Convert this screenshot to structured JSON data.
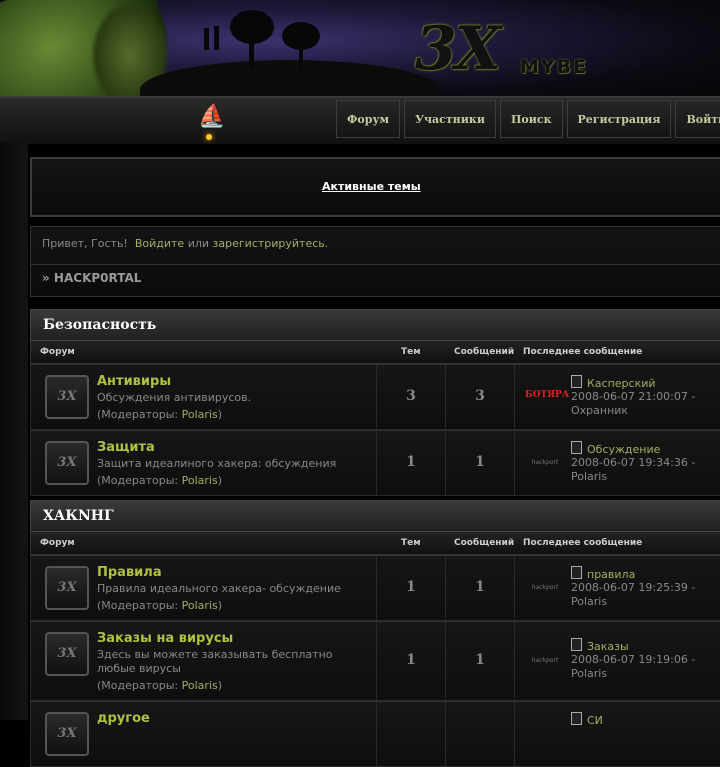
{
  "header": {
    "logo_main": "3X",
    "logo_sub": "MYBE"
  },
  "nav": {
    "items": [
      "Форум",
      "Участники",
      "Поиск",
      "Регистрация",
      "Войти"
    ]
  },
  "active_topics": {
    "label": "Активные темы"
  },
  "greeting": {
    "prefix": "Привет, Гость!",
    "login": "Войдите",
    "or": "или",
    "register": "зарегистрируйтесь",
    "dot": ".",
    "breadcrumb": "» HACKP0RTAL"
  },
  "columns": {
    "forum": "Форум",
    "topics": "Тем",
    "posts": "Сообщений",
    "last": "Последнее сообщение"
  },
  "categories": [
    {
      "title": "Безопасность",
      "forums": [
        {
          "name": "Антивиры",
          "desc": "Обсуждения антивирусов.",
          "mods_label": "Модераторы:",
          "mod": "Polaris",
          "topics": "3",
          "posts": "3",
          "avatar": "БОТЯРА",
          "last_title": "Касперский",
          "last_date": "2008-06-07 21:00:07 -",
          "last_author": "Охранник"
        },
        {
          "name": "Защита",
          "desc": "Защита идеалиного хакера: обсуждения",
          "mods_label": "Модераторы:",
          "mod": "Polaris",
          "topics": "1",
          "posts": "1",
          "avatar": "hackport",
          "last_title": "Обсуждение",
          "last_date": "2008-06-07 19:34:36 -",
          "last_author": "Polaris"
        }
      ]
    },
    {
      "title": "ХАКNНГ",
      "forums": [
        {
          "name": "Правила",
          "desc": "Правила идеального хакера- обсуждение",
          "mods_label": "Модераторы:",
          "mod": "Polaris",
          "topics": "1",
          "posts": "1",
          "avatar": "hackport",
          "last_title": "правила",
          "last_date": "2008-06-07 19:25:39 -",
          "last_author": "Polaris"
        },
        {
          "name": "Заказы на вирусы",
          "desc": "Здесь вы можете заказывать бесплатно любые вирусы",
          "mods_label": "Модераторы:",
          "mod": "Polaris",
          "topics": "1",
          "posts": "1",
          "avatar": "hackport",
          "last_title": "Заказы",
          "last_date": "2008-06-07 19:19:06 -",
          "last_author": "Polaris"
        },
        {
          "name": "другое",
          "last_title": "СИ"
        }
      ]
    }
  ]
}
